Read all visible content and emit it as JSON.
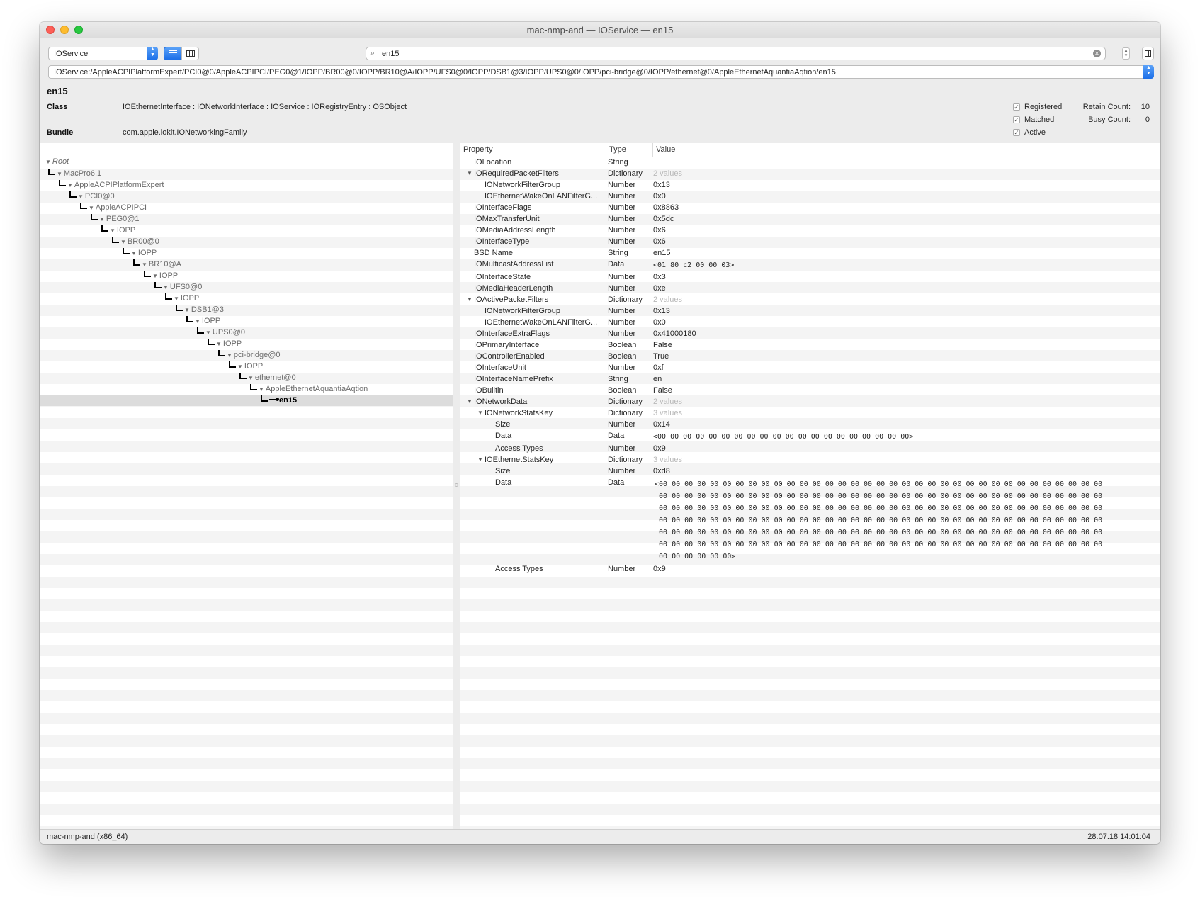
{
  "window": {
    "title": "mac-nmp-and — IOService — en15"
  },
  "toolbar": {
    "plane": "IOService",
    "search_value": "en15",
    "path": "IOService:/AppleACPIPlatformExpert/PCI0@0/AppleACPIPCI/PEG0@1/IOPP/BR00@0/IOPP/BR10@A/IOPP/UFS0@0/IOPP/DSB1@3/IOPP/UPS0@0/IOPP/pci-bridge@0/IOPP/ethernet@0/AppleEthernetAquantiaAqtion/en15"
  },
  "header": {
    "name": "en15",
    "class_label": "Class",
    "class_value": "IOEthernetInterface : IONetworkInterface : IOService : IORegistryEntry : OSObject",
    "bundle_label": "Bundle",
    "bundle_value": "com.apple.iokit.IONetworkingFamily",
    "checks": [
      {
        "label": "Registered",
        "checked": true
      },
      {
        "label": "Matched",
        "checked": true
      },
      {
        "label": "Active",
        "checked": true
      }
    ],
    "retain_label": "Retain Count:",
    "retain_value": "10",
    "busy_label": "Busy Count:",
    "busy_value": "0"
  },
  "tree": [
    {
      "label": "Root",
      "depth": 0,
      "italic": true
    },
    {
      "label": "MacPro6,1",
      "depth": 1
    },
    {
      "label": "AppleACPIPlatformExpert",
      "depth": 2
    },
    {
      "label": "PCI0@0",
      "depth": 3
    },
    {
      "label": "AppleACPIPCI",
      "depth": 4
    },
    {
      "label": "PEG0@1",
      "depth": 5
    },
    {
      "label": "IOPP",
      "depth": 6
    },
    {
      "label": "BR00@0",
      "depth": 7
    },
    {
      "label": "IOPP",
      "depth": 8
    },
    {
      "label": "BR10@A",
      "depth": 9
    },
    {
      "label": "IOPP",
      "depth": 10
    },
    {
      "label": "UFS0@0",
      "depth": 11
    },
    {
      "label": "IOPP",
      "depth": 12
    },
    {
      "label": "DSB1@3",
      "depth": 13
    },
    {
      "label": "IOPP",
      "depth": 14
    },
    {
      "label": "UPS0@0",
      "depth": 15
    },
    {
      "label": "IOPP",
      "depth": 16
    },
    {
      "label": "pci-bridge@0",
      "depth": 17
    },
    {
      "label": "IOPP",
      "depth": 18
    },
    {
      "label": "ethernet@0",
      "depth": 19
    },
    {
      "label": "AppleEthernetAquantiaAqtion",
      "depth": 20
    },
    {
      "label": "en15",
      "depth": 21,
      "selected": true,
      "leaf": true
    }
  ],
  "columns": {
    "property": "Property",
    "type": "Type",
    "value": "Value"
  },
  "properties": [
    {
      "name": "IOLocation",
      "type": "String",
      "value": "",
      "indent": 0
    },
    {
      "name": "IORequiredPacketFilters",
      "type": "Dictionary",
      "value": "2 values",
      "indent": 0,
      "expanded": true,
      "muted": true
    },
    {
      "name": "IONetworkFilterGroup",
      "type": "Number",
      "value": "0x13",
      "indent": 1
    },
    {
      "name": "IOEthernetWakeOnLANFilterG...",
      "type": "Number",
      "value": "0x0",
      "indent": 1
    },
    {
      "name": "IOInterfaceFlags",
      "type": "Number",
      "value": "0x8863",
      "indent": 0
    },
    {
      "name": "IOMaxTransferUnit",
      "type": "Number",
      "value": "0x5dc",
      "indent": 0
    },
    {
      "name": "IOMediaAddressLength",
      "type": "Number",
      "value": "0x6",
      "indent": 0
    },
    {
      "name": "IOInterfaceType",
      "type": "Number",
      "value": "0x6",
      "indent": 0
    },
    {
      "name": "BSD Name",
      "type": "String",
      "value": "en15",
      "indent": 0
    },
    {
      "name": "IOMulticastAddressList",
      "type": "Data",
      "value": "<01 80 c2 00 00 03>",
      "indent": 0,
      "mono": true
    },
    {
      "name": "IOInterfaceState",
      "type": "Number",
      "value": "0x3",
      "indent": 0
    },
    {
      "name": "IOMediaHeaderLength",
      "type": "Number",
      "value": "0xe",
      "indent": 0
    },
    {
      "name": "IOActivePacketFilters",
      "type": "Dictionary",
      "value": "2 values",
      "indent": 0,
      "expanded": true,
      "muted": true
    },
    {
      "name": "IONetworkFilterGroup",
      "type": "Number",
      "value": "0x13",
      "indent": 1
    },
    {
      "name": "IOEthernetWakeOnLANFilterG...",
      "type": "Number",
      "value": "0x0",
      "indent": 1
    },
    {
      "name": "IOInterfaceExtraFlags",
      "type": "Number",
      "value": "0x41000180",
      "indent": 0
    },
    {
      "name": "IOPrimaryInterface",
      "type": "Boolean",
      "value": "False",
      "indent": 0
    },
    {
      "name": "IOControllerEnabled",
      "type": "Boolean",
      "value": "True",
      "indent": 0
    },
    {
      "name": "IOInterfaceUnit",
      "type": "Number",
      "value": "0xf",
      "indent": 0
    },
    {
      "name": "IOInterfaceNamePrefix",
      "type": "String",
      "value": "en",
      "indent": 0
    },
    {
      "name": "IOBuiltin",
      "type": "Boolean",
      "value": "False",
      "indent": 0
    },
    {
      "name": "IONetworkData",
      "type": "Dictionary",
      "value": "2 values",
      "indent": 0,
      "expanded": true,
      "muted": true
    },
    {
      "name": "IONetworkStatsKey",
      "type": "Dictionary",
      "value": "3 values",
      "indent": 1,
      "expanded": true,
      "muted": true
    },
    {
      "name": "Size",
      "type": "Number",
      "value": "0x14",
      "indent": 2
    },
    {
      "name": "Data",
      "type": "Data",
      "value": "<00 00 00 00 00 00 00 00 00 00 00 00 00 00 00 00 00 00 00 00>",
      "indent": 2,
      "mono": true
    },
    {
      "name": "Access Types",
      "type": "Number",
      "value": "0x9",
      "indent": 2
    },
    {
      "name": "IOEthernetStatsKey",
      "type": "Dictionary",
      "value": "3 values",
      "indent": 1,
      "expanded": true,
      "muted": true
    },
    {
      "name": "Size",
      "type": "Number",
      "value": "0xd8",
      "indent": 2
    },
    {
      "name": "Data",
      "type": "Data",
      "indent": 2,
      "hex_lines": [
        "<00 00 00 00 00 00 00 00 00 00 00 00 00 00 00 00 00 00 00 00 00 00 00 00 00 00 00 00 00 00 00 00 00 00 00",
        " 00 00 00 00 00 00 00 00 00 00 00 00 00 00 00 00 00 00 00 00 00 00 00 00 00 00 00 00 00 00 00 00 00 00 00",
        " 00 00 00 00 00 00 00 00 00 00 00 00 00 00 00 00 00 00 00 00 00 00 00 00 00 00 00 00 00 00 00 00 00 00 00",
        " 00 00 00 00 00 00 00 00 00 00 00 00 00 00 00 00 00 00 00 00 00 00 00 00 00 00 00 00 00 00 00 00 00 00 00",
        " 00 00 00 00 00 00 00 00 00 00 00 00 00 00 00 00 00 00 00 00 00 00 00 00 00 00 00 00 00 00 00 00 00 00 00",
        " 00 00 00 00 00 00 00 00 00 00 00 00 00 00 00 00 00 00 00 00 00 00 00 00 00 00 00 00 00 00 00 00 00 00 00",
        " 00 00 00 00 00 00>"
      ]
    },
    {
      "name": "Access Types",
      "type": "Number",
      "value": "0x9",
      "indent": 2
    }
  ],
  "status": {
    "machine": "mac-nmp-and (x86_64)",
    "timestamp": "28.07.18 14:01:04"
  },
  "icons": {
    "search": "search-icon",
    "clear": "clear-search-icon",
    "inspector": "inspector-icon"
  },
  "colors": {
    "accent": "#1c6fe8",
    "selected_row": "#dcdcdc"
  }
}
